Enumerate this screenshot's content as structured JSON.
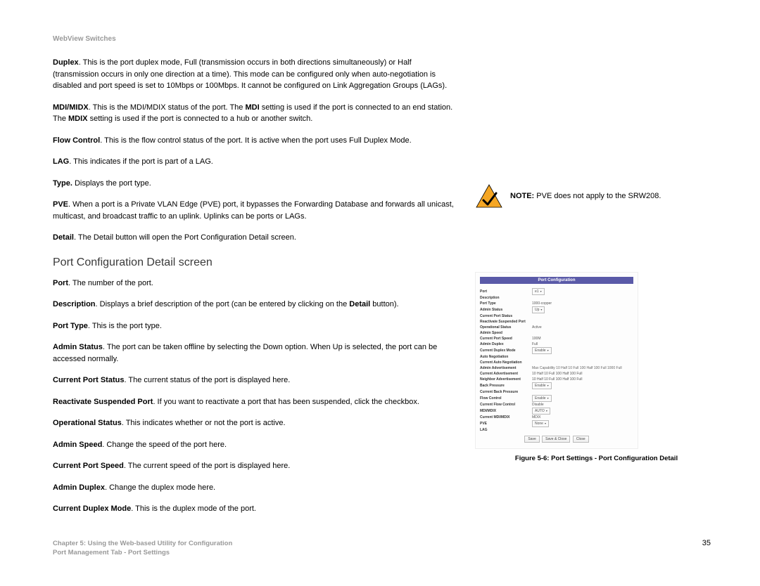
{
  "header": "WebView Switches",
  "paragraphs": {
    "duplex": {
      "label": "Duplex",
      "text": ". This is the port duplex mode, Full (transmission occurs in both directions simultaneously) or Half (transmission occurs in only one direction at a time). This mode can be configured only when auto-negotiation is disabled and port speed is set to 10Mbps or 100Mbps. It cannot be configured on Link Aggregation Groups (LAGs)."
    },
    "mdi": {
      "prefix": "MDI/MIDX",
      "text1": ". This is the MDI/MDIX status of the port. The ",
      "bold1": "MDI",
      "text2": " setting is used if the port is connected to an end station. The ",
      "bold2": "MDIX",
      "text3": " setting is used if the port is connected to a hub or another switch."
    },
    "flow": {
      "label": "Flow Control",
      "text": ". This is the flow control status of the port. It is active when the port uses Full Duplex Mode."
    },
    "lag": {
      "label": "LAG",
      "text": ". This indicates if the port is part of a LAG."
    },
    "type": {
      "label": "Type.",
      "text": " Displays the port type."
    },
    "pve": {
      "label": "PVE",
      "text": ". When a port is a Private VLAN Edge (PVE) port, it bypasses the Forwarding Database and forwards all unicast, multicast, and broadcast traffic to an uplink. Uplinks can be ports or LAGs."
    },
    "detail_btn": {
      "label": "Detail",
      "text": ". The Detail button will open the Port Configuration Detail screen."
    }
  },
  "section_heading": "Port Configuration Detail screen",
  "detail_items": {
    "port": {
      "label": "Port",
      "text": ". The number of the port."
    },
    "description": {
      "label": "Description",
      "text1": ". Displays a brief description of the port (can be entered by clicking on the ",
      "bold": "Detail",
      "text2": " button)."
    },
    "port_type": {
      "label": "Port Type",
      "text": ". This is the port type."
    },
    "admin_status": {
      "label": "Admin Status",
      "text": ". The port can be taken offline by selecting the Down option. When Up is selected, the port can be accessed normally."
    },
    "current_port_status": {
      "label": "Current Port Status",
      "text": ". The current status of the port is displayed here."
    },
    "reactivate": {
      "label": "Reactivate Suspended Port",
      "text": ". If you want to reactivate a port that has been suspended, click the checkbox."
    },
    "operational_status": {
      "label": "Operational Status",
      "text": ". This indicates whether or not the port is active."
    },
    "admin_speed": {
      "label": "Admin Speed",
      "text": ". Change the speed of the port here."
    },
    "current_port_speed": {
      "label": "Current Port Speed",
      "text": ". The current speed of the port is displayed here."
    },
    "admin_duplex": {
      "label": "Admin Duplex",
      "text": ". Change the duplex mode here."
    },
    "current_duplex": {
      "label": "Current Duplex Mode",
      "text": ". This is the duplex mode of the port."
    }
  },
  "note": {
    "bold": "NOTE:",
    "text": "  PVE does not apply to the SRW208."
  },
  "figure": {
    "title": "Port Configuration",
    "caption": "Figure 5-6: Port Settings - Port Configuration Detail",
    "rows": {
      "port": "Port",
      "port_val": "e1",
      "description": "Description",
      "port_type": "Port Type",
      "port_type_val": "1000-copper",
      "admin_status": "Admin Status",
      "admin_status_val": "Up",
      "current_port_status": "Current Port Status",
      "reactivate": "Reactivate Suspended Port",
      "operational_status": "Operational Status",
      "operational_status_val": "Active",
      "admin_speed": "Admin Speed",
      "current_port_speed": "Current Port Speed",
      "current_port_speed_val": "100M",
      "admin_duplex": "Admin Duplex",
      "admin_duplex_val": "Full",
      "current_duplex": "Current Duplex Mode",
      "current_duplex_val": "Enable",
      "auto_neg": "Auto Negotiation",
      "current_auto_neg": "Current Auto Negotiation",
      "admin_adv": "Admin Advertisement",
      "admin_adv_opts": "Max Capability   10 Half   10 Full   100 Half   100 Full   1000 Full",
      "current_adv": "Current Advertisement",
      "current_adv_val": "10 Half 10 Full 100 Half 100 Full",
      "neighbor_adv": "Neighbor Advertisement",
      "neighbor_adv_val": "10 Half 10 Full 100 Half 100 Full",
      "back_pressure": "Back Pressure",
      "back_pressure_val": "Enable",
      "current_back_pressure": "Current Back Pressure",
      "flow_control": "Flow Control",
      "flow_control_val": "Enable",
      "current_flow": "Current Flow Control",
      "current_flow_val": "Disable",
      "mdimdix": "MDI/MDIX",
      "mdimdix_val": "AUTO",
      "current_mdi": "Current MDI/MDIX",
      "current_mdi_val": "MDIX",
      "pve": "PVE",
      "pve_val": "None",
      "lag": "LAG"
    },
    "buttons": {
      "save": "Save",
      "save_close": "Save & Close",
      "close": "Close"
    }
  },
  "footer": {
    "chapter": "Chapter 5: Using the Web-based Utility for Configuration",
    "section": "Port Management Tab - Port Settings",
    "page": "35"
  }
}
